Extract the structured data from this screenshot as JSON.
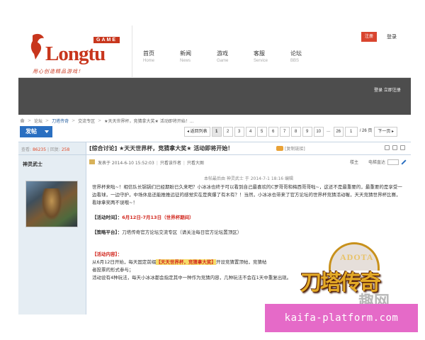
{
  "header": {
    "logo_tag": "GAME",
    "logo_word": "Longtu",
    "logo_slogan": "用心创造精品游戏！",
    "nav": [
      {
        "zh": "首页",
        "en": "Home"
      },
      {
        "zh": "新闻",
        "en": "News"
      },
      {
        "zh": "游戏",
        "en": "Game"
      },
      {
        "zh": "客服",
        "en": "Service"
      },
      {
        "zh": "论坛",
        "en": "BBS"
      }
    ],
    "register_label": "注册",
    "login_label": "登录"
  },
  "darkbar": {
    "login_link": "登录  立即注册"
  },
  "breadcrumb": {
    "items": [
      "论坛",
      "刀塔传奇",
      "交流专区",
      "★天天世界杯，竞猜拿大奖★ 活动即将开始！..."
    ],
    "separator": ">"
  },
  "pagerow": {
    "post_label": "发帖",
    "back_label": "◂ 返回列表",
    "pages": [
      "1",
      "2",
      "3",
      "4",
      "5",
      "6",
      "7",
      "8",
      "9",
      "10"
    ],
    "ellipsis": "...",
    "last_page": "26",
    "page_input": "1",
    "total_pages": "/ 26 页",
    "next_label": "下一页 ▸",
    "current_page": "1"
  },
  "side": {
    "views_label": "查看:",
    "views": "86235",
    "replies_label": "回复:",
    "replies": "258",
    "author": "神灵武士"
  },
  "thread": {
    "title": "[综合讨论] ★天天世界杯，竞猜拿大奖★ 活动即将开始！",
    "copy_link": "[复制链接]",
    "meta_posted": "发表于 2014-6-10 15:52:03",
    "meta_only_author": "只看该作者",
    "meta_only_big": "只看大图",
    "floor_label": "楼主",
    "jump_label": "电梯直达",
    "edit_note": "本帖最后由 神灵武士 于 2014-7-1 18:16 编辑",
    "intro": "世界杯来啦~！相信队长锅锅们已经期盼已久来吧？小冰冰也终于可以看到自己最喜欢的C罗哥哥和梅西哥哥啦~，这还不是最重要的，最重要的是享受一边看球，一边守护，中场休息还能推推远征的感觉实在是爽爆了有木有？！当然，小冰冰也带来了官方论坛的世界杯竞猜活动喔，天天竞猜世界杯比赛，看球拿奖两不误哦~！",
    "time_label": "【活动时间】：",
    "time_value": "6月12日-7月13日（世界杯期间）",
    "platform_label": "【策略平台】：",
    "platform_value": "刀塔传奇官方论坛交流专区（请关注每日官方论坛置顶区）",
    "content_label": "【活动内容】：",
    "content_line1_a": "从6月12日开始，每天固定前缀",
    "content_line1_hl": "【天天世界杯，竞猜拿大奖】",
    "content_line1_b": "开设竞猜置顶帖，竞猜帖",
    "content_line2": "者投票的形式参与；",
    "content_line3": "活动设有4种玩法，每天小冰冰都会指定其中一种作为竞猜内容，几种玩法不会在1天中重复出现。"
  },
  "overlays": {
    "game_logo_top": "ADOTA",
    "game_logo_main": "刀塔传奇",
    "game_logo_sub": "趣网",
    "watermark": "kaifa-platform.com"
  },
  "colors": {
    "brand_red": "#c8361d",
    "post_button_blue": "#2a6fc1",
    "dark_bar": "#4d4d4d",
    "sidebar_bg": "#e5edf3",
    "accent_red": "#d2281f",
    "watermark_pink": "#e56ac8"
  }
}
